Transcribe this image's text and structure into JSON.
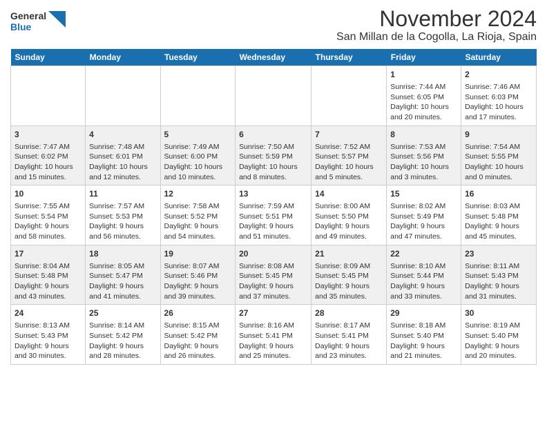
{
  "header": {
    "logo_line1": "General",
    "logo_line2": "Blue",
    "title": "November 2024",
    "subtitle": "San Millan de la Cogolla, La Rioja, Spain"
  },
  "calendar": {
    "days_of_week": [
      "Sunday",
      "Monday",
      "Tuesday",
      "Wednesday",
      "Thursday",
      "Friday",
      "Saturday"
    ],
    "weeks": [
      [
        {
          "day": "",
          "info": ""
        },
        {
          "day": "",
          "info": ""
        },
        {
          "day": "",
          "info": ""
        },
        {
          "day": "",
          "info": ""
        },
        {
          "day": "",
          "info": ""
        },
        {
          "day": "1",
          "info": "Sunrise: 7:44 AM\nSunset: 6:05 PM\nDaylight: 10 hours and 20 minutes."
        },
        {
          "day": "2",
          "info": "Sunrise: 7:46 AM\nSunset: 6:03 PM\nDaylight: 10 hours and 17 minutes."
        }
      ],
      [
        {
          "day": "3",
          "info": "Sunrise: 7:47 AM\nSunset: 6:02 PM\nDaylight: 10 hours and 15 minutes."
        },
        {
          "day": "4",
          "info": "Sunrise: 7:48 AM\nSunset: 6:01 PM\nDaylight: 10 hours and 12 minutes."
        },
        {
          "day": "5",
          "info": "Sunrise: 7:49 AM\nSunset: 6:00 PM\nDaylight: 10 hours and 10 minutes."
        },
        {
          "day": "6",
          "info": "Sunrise: 7:50 AM\nSunset: 5:59 PM\nDaylight: 10 hours and 8 minutes."
        },
        {
          "day": "7",
          "info": "Sunrise: 7:52 AM\nSunset: 5:57 PM\nDaylight: 10 hours and 5 minutes."
        },
        {
          "day": "8",
          "info": "Sunrise: 7:53 AM\nSunset: 5:56 PM\nDaylight: 10 hours and 3 minutes."
        },
        {
          "day": "9",
          "info": "Sunrise: 7:54 AM\nSunset: 5:55 PM\nDaylight: 10 hours and 0 minutes."
        }
      ],
      [
        {
          "day": "10",
          "info": "Sunrise: 7:55 AM\nSunset: 5:54 PM\nDaylight: 9 hours and 58 minutes."
        },
        {
          "day": "11",
          "info": "Sunrise: 7:57 AM\nSunset: 5:53 PM\nDaylight: 9 hours and 56 minutes."
        },
        {
          "day": "12",
          "info": "Sunrise: 7:58 AM\nSunset: 5:52 PM\nDaylight: 9 hours and 54 minutes."
        },
        {
          "day": "13",
          "info": "Sunrise: 7:59 AM\nSunset: 5:51 PM\nDaylight: 9 hours and 51 minutes."
        },
        {
          "day": "14",
          "info": "Sunrise: 8:00 AM\nSunset: 5:50 PM\nDaylight: 9 hours and 49 minutes."
        },
        {
          "day": "15",
          "info": "Sunrise: 8:02 AM\nSunset: 5:49 PM\nDaylight: 9 hours and 47 minutes."
        },
        {
          "day": "16",
          "info": "Sunrise: 8:03 AM\nSunset: 5:48 PM\nDaylight: 9 hours and 45 minutes."
        }
      ],
      [
        {
          "day": "17",
          "info": "Sunrise: 8:04 AM\nSunset: 5:48 PM\nDaylight: 9 hours and 43 minutes."
        },
        {
          "day": "18",
          "info": "Sunrise: 8:05 AM\nSunset: 5:47 PM\nDaylight: 9 hours and 41 minutes."
        },
        {
          "day": "19",
          "info": "Sunrise: 8:07 AM\nSunset: 5:46 PM\nDaylight: 9 hours and 39 minutes."
        },
        {
          "day": "20",
          "info": "Sunrise: 8:08 AM\nSunset: 5:45 PM\nDaylight: 9 hours and 37 minutes."
        },
        {
          "day": "21",
          "info": "Sunrise: 8:09 AM\nSunset: 5:45 PM\nDaylight: 9 hours and 35 minutes."
        },
        {
          "day": "22",
          "info": "Sunrise: 8:10 AM\nSunset: 5:44 PM\nDaylight: 9 hours and 33 minutes."
        },
        {
          "day": "23",
          "info": "Sunrise: 8:11 AM\nSunset: 5:43 PM\nDaylight: 9 hours and 31 minutes."
        }
      ],
      [
        {
          "day": "24",
          "info": "Sunrise: 8:13 AM\nSunset: 5:43 PM\nDaylight: 9 hours and 30 minutes."
        },
        {
          "day": "25",
          "info": "Sunrise: 8:14 AM\nSunset: 5:42 PM\nDaylight: 9 hours and 28 minutes."
        },
        {
          "day": "26",
          "info": "Sunrise: 8:15 AM\nSunset: 5:42 PM\nDaylight: 9 hours and 26 minutes."
        },
        {
          "day": "27",
          "info": "Sunrise: 8:16 AM\nSunset: 5:41 PM\nDaylight: 9 hours and 25 minutes."
        },
        {
          "day": "28",
          "info": "Sunrise: 8:17 AM\nSunset: 5:41 PM\nDaylight: 9 hours and 23 minutes."
        },
        {
          "day": "29",
          "info": "Sunrise: 8:18 AM\nSunset: 5:40 PM\nDaylight: 9 hours and 21 minutes."
        },
        {
          "day": "30",
          "info": "Sunrise: 8:19 AM\nSunset: 5:40 PM\nDaylight: 9 hours and 20 minutes."
        }
      ]
    ]
  }
}
